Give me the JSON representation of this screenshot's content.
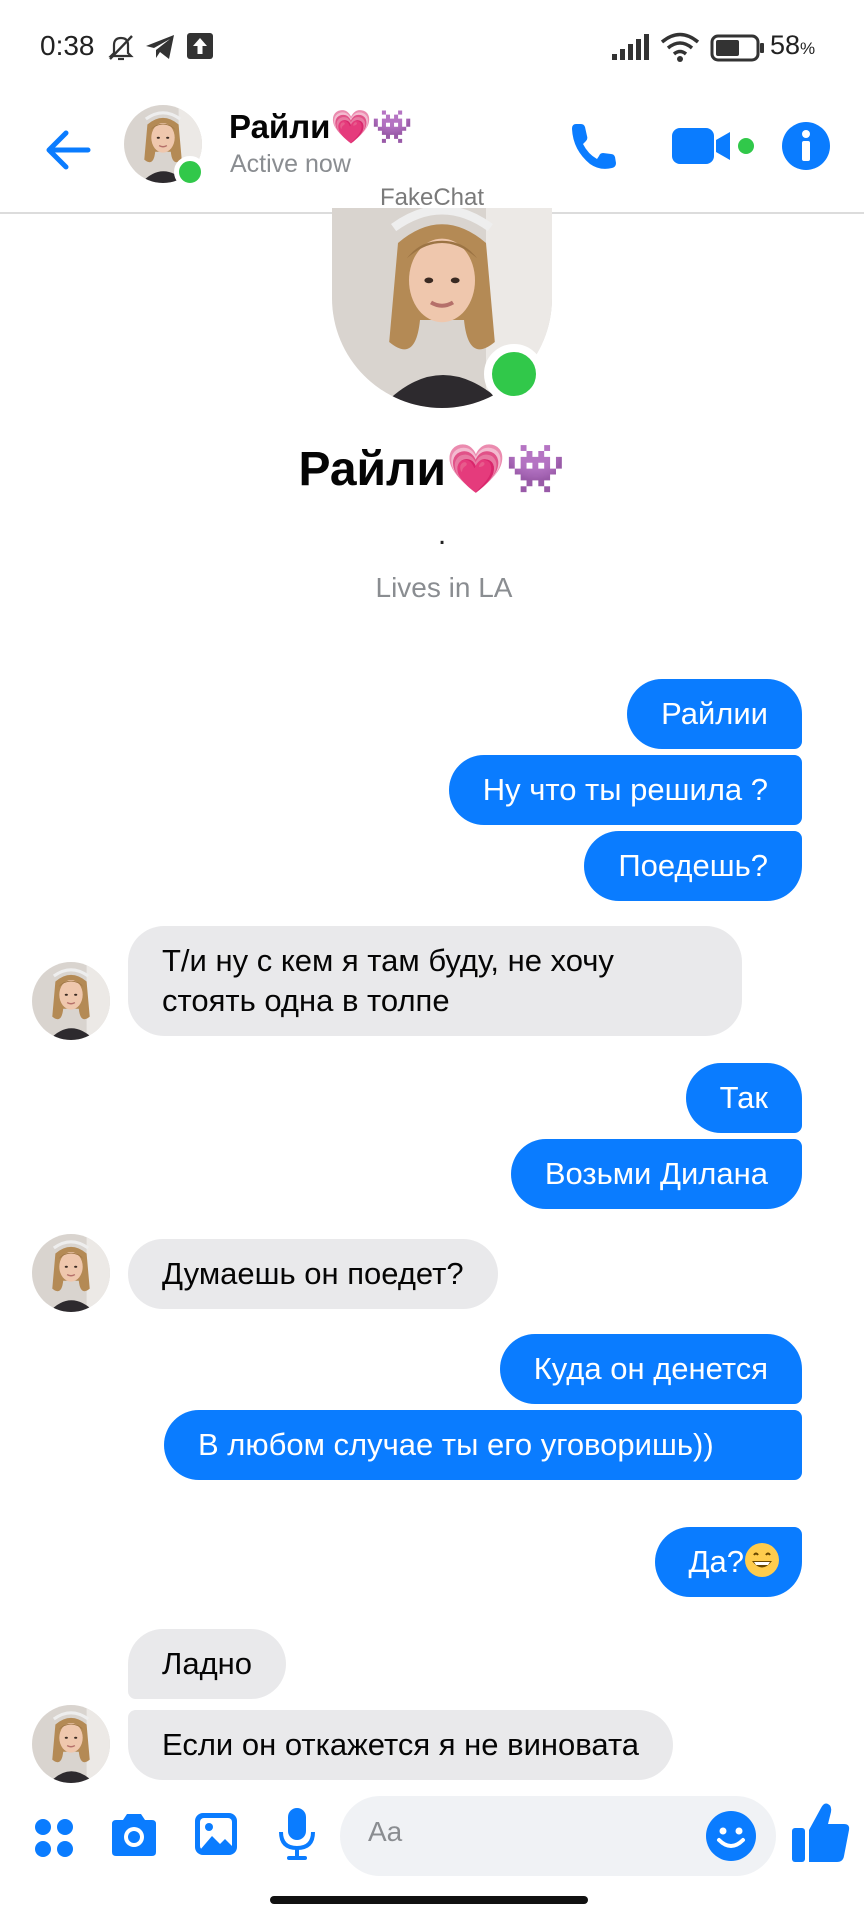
{
  "status_bar": {
    "time": "0:38",
    "battery_pct": "58",
    "battery_unit": "%",
    "icons": [
      "bell-off-icon",
      "telegram-icon",
      "upload-icon",
      "signal-icon",
      "wifi-icon",
      "battery-icon"
    ]
  },
  "header": {
    "contact_name": "Райли💗👾",
    "status": "Active now",
    "icons": [
      "back-arrow-icon",
      "phone-icon",
      "video-camera-icon",
      "info-icon"
    ]
  },
  "watermark": "FakeChat",
  "profile": {
    "name": "Райли💗👾",
    "bio": ".",
    "lives": "Lives in  LA"
  },
  "messages": [
    {
      "side": "out",
      "text": "Райлии"
    },
    {
      "side": "out",
      "text": "Ну что ты решила ?"
    },
    {
      "side": "out",
      "text": "Поедешь?"
    },
    {
      "side": "in",
      "text": "Т/и ну с кем я там буду, не хочу стоять одна в толпе"
    },
    {
      "side": "out",
      "text": "Так"
    },
    {
      "side": "out",
      "text": "Возьми Дилана"
    },
    {
      "side": "in",
      "text": "Думаешь он поедет?"
    },
    {
      "side": "out",
      "text": "Куда он денется"
    },
    {
      "side": "out",
      "text": "В любом случае ты его уговоришь))"
    },
    {
      "side": "out",
      "text": "Да?"
    },
    {
      "side": "in",
      "text": "Ладно"
    },
    {
      "side": "in",
      "text": "Если он откажется я не виновата"
    }
  ],
  "composer": {
    "placeholder": "Aa",
    "icons": [
      "apps-icon",
      "camera-icon",
      "gallery-icon",
      "microphone-icon",
      "emoji-icon",
      "thumbs-up-icon"
    ]
  },
  "colors": {
    "accent": "#0a7cff",
    "incoming_bubble": "#e9e9eb",
    "online": "#31c84a"
  }
}
